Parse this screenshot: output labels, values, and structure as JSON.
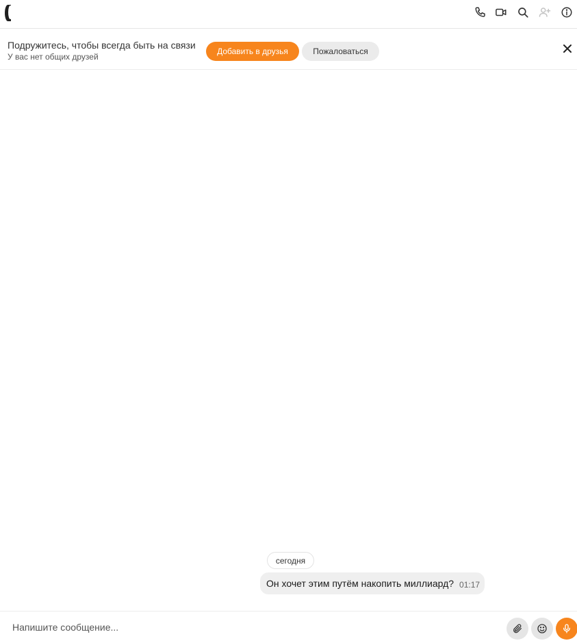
{
  "header": {
    "toolbar_icons": [
      "phone-icon",
      "video-camera-icon",
      "search-icon",
      "add-friend-icon",
      "info-icon"
    ]
  },
  "banner": {
    "title": "Подружитесь, чтобы всегда быть на связи",
    "subtitle": "У вас нет общих друзей",
    "add_friend_label": "Добавить в друзья",
    "report_label": "Пожаловаться"
  },
  "chat": {
    "date_label": "сегодня",
    "messages": [
      {
        "text": "Он хочет этим путём накопить миллиард?",
        "time": "01:17"
      }
    ]
  },
  "composer": {
    "placeholder": "Напишите сообщение..."
  },
  "colors": {
    "accent": "#f7851d",
    "button_gray": "#ebebeb",
    "bubble": "#efefef"
  }
}
